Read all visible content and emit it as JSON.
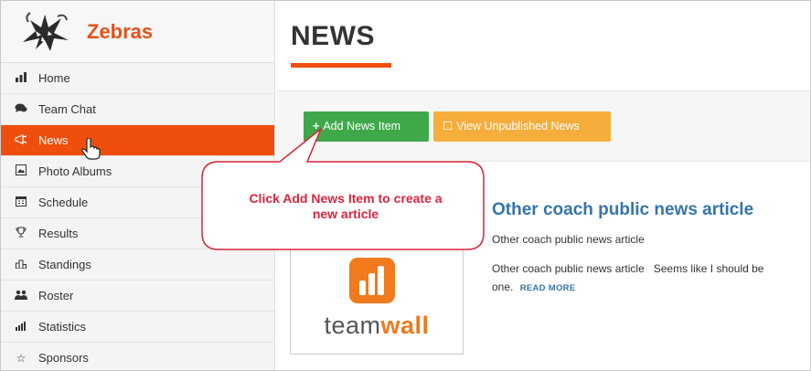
{
  "brand": {
    "name": "Zebras"
  },
  "sidebar": {
    "items": [
      {
        "label": "Home",
        "icon": "bar-chart-icon"
      },
      {
        "label": "Team Chat",
        "icon": "chat-bubbles-icon"
      },
      {
        "label": "News",
        "icon": "megaphone-icon",
        "active": true
      },
      {
        "label": "Photo Albums",
        "icon": "photo-icon"
      },
      {
        "label": "Schedule",
        "icon": "calendar-icon"
      },
      {
        "label": "Results",
        "icon": "trophy-icon"
      },
      {
        "label": "Standings",
        "icon": "podium-icon"
      },
      {
        "label": "Roster",
        "icon": "users-icon"
      },
      {
        "label": "Statistics",
        "icon": "stats-icon"
      },
      {
        "label": "Sponsors",
        "icon": "star-outline-icon"
      }
    ]
  },
  "main": {
    "title": "NEWS",
    "add_button": "Add News Item",
    "view_button": "View Unpublished News",
    "article": {
      "title": "Other coach public news article",
      "subtitle": "Other coach public news article",
      "body": "Other coach public news article   Seems like I should be",
      "body_cont": "one.",
      "read_more": "READ MORE",
      "thumb_text_plain": "team",
      "thumb_text_bold": "wall"
    }
  },
  "callout": {
    "line1": "Click Add News Item to create a",
    "line2": "new article"
  },
  "colors": {
    "accent": "#f04e0c",
    "add_button": "#3fa84a",
    "view_button": "#f5ad3c",
    "article_link": "#3574ad",
    "callout_text": "#e0233c"
  }
}
